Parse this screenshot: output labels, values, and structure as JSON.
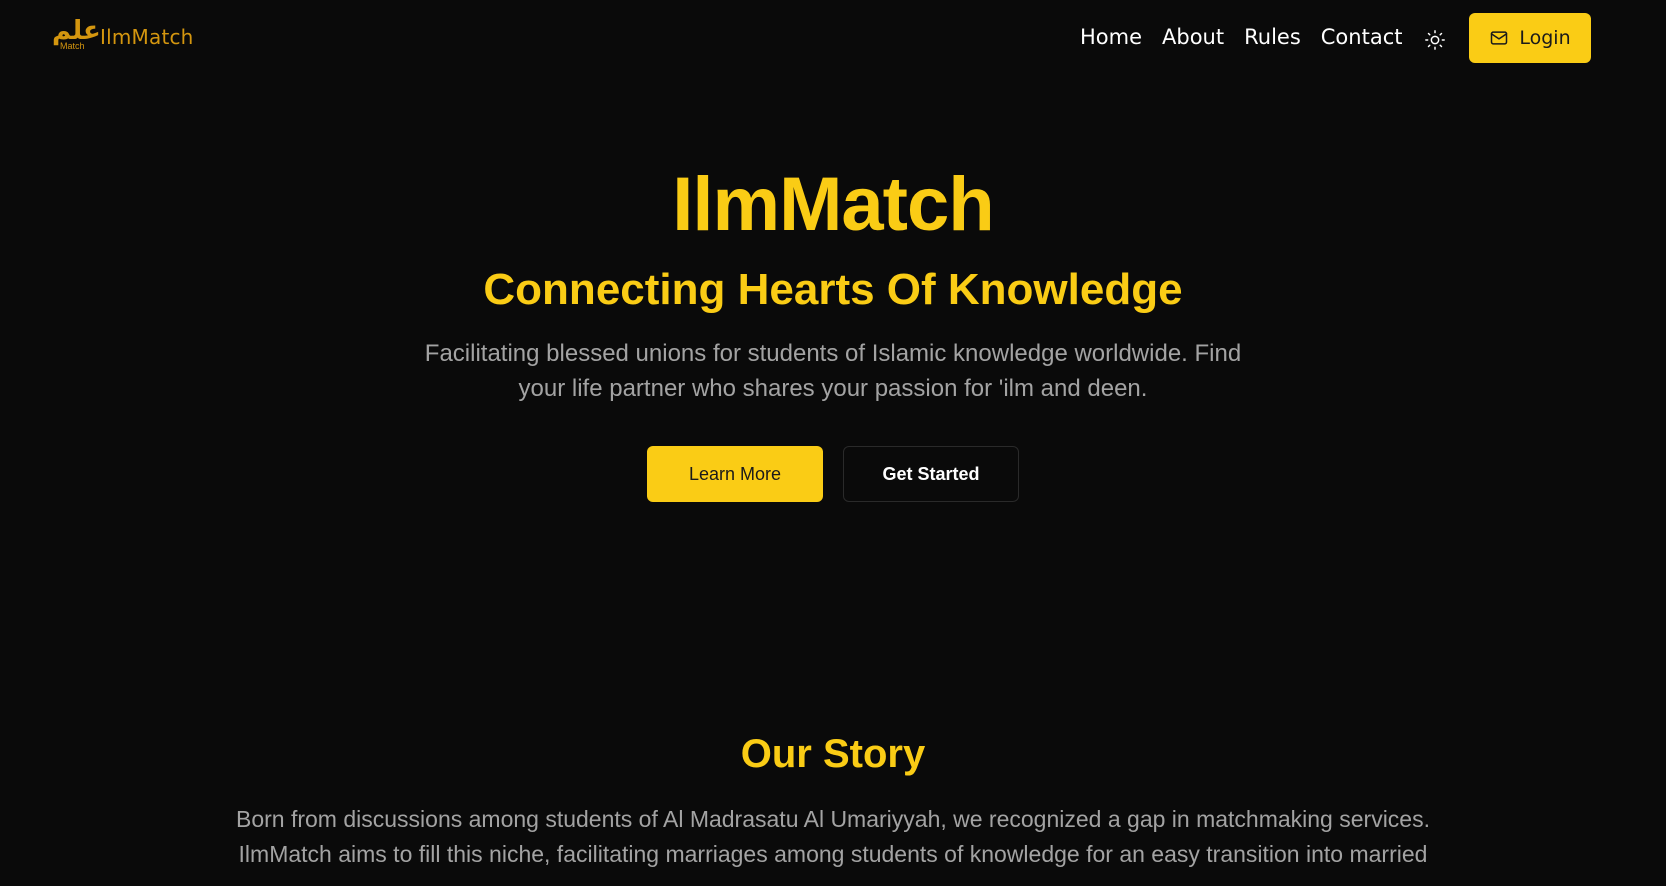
{
  "brand": {
    "logo_arabic": "علم",
    "logo_sub": "Match",
    "name": "IlmMatch"
  },
  "nav": {
    "links": [
      {
        "label": "Home"
      },
      {
        "label": "About"
      },
      {
        "label": "Rules"
      },
      {
        "label": "Contact"
      }
    ],
    "theme_toggle_icon": "sun-icon",
    "login_icon": "mail-icon",
    "login_label": "Login"
  },
  "hero": {
    "title": "IlmMatch",
    "subtitle": "Connecting Hearts Of Knowledge",
    "description": "Facilitating blessed unions for students of Islamic knowledge worldwide. Find your life partner who shares your passion for 'ilm and deen.",
    "primary_button": "Learn More",
    "secondary_button": "Get Started"
  },
  "story": {
    "title": "Our Story",
    "text": "Born from discussions among students of Al Madrasatu Al Umariyyah, we recognized a gap in matchmaking services. IlmMatch aims to fill this niche, facilitating marriages among students of knowledge for an easy transition into married"
  },
  "colors": {
    "background": "#0a0a0a",
    "accent": "#facc15",
    "brand": "#d4960f",
    "muted_text": "#a3a3a3"
  }
}
